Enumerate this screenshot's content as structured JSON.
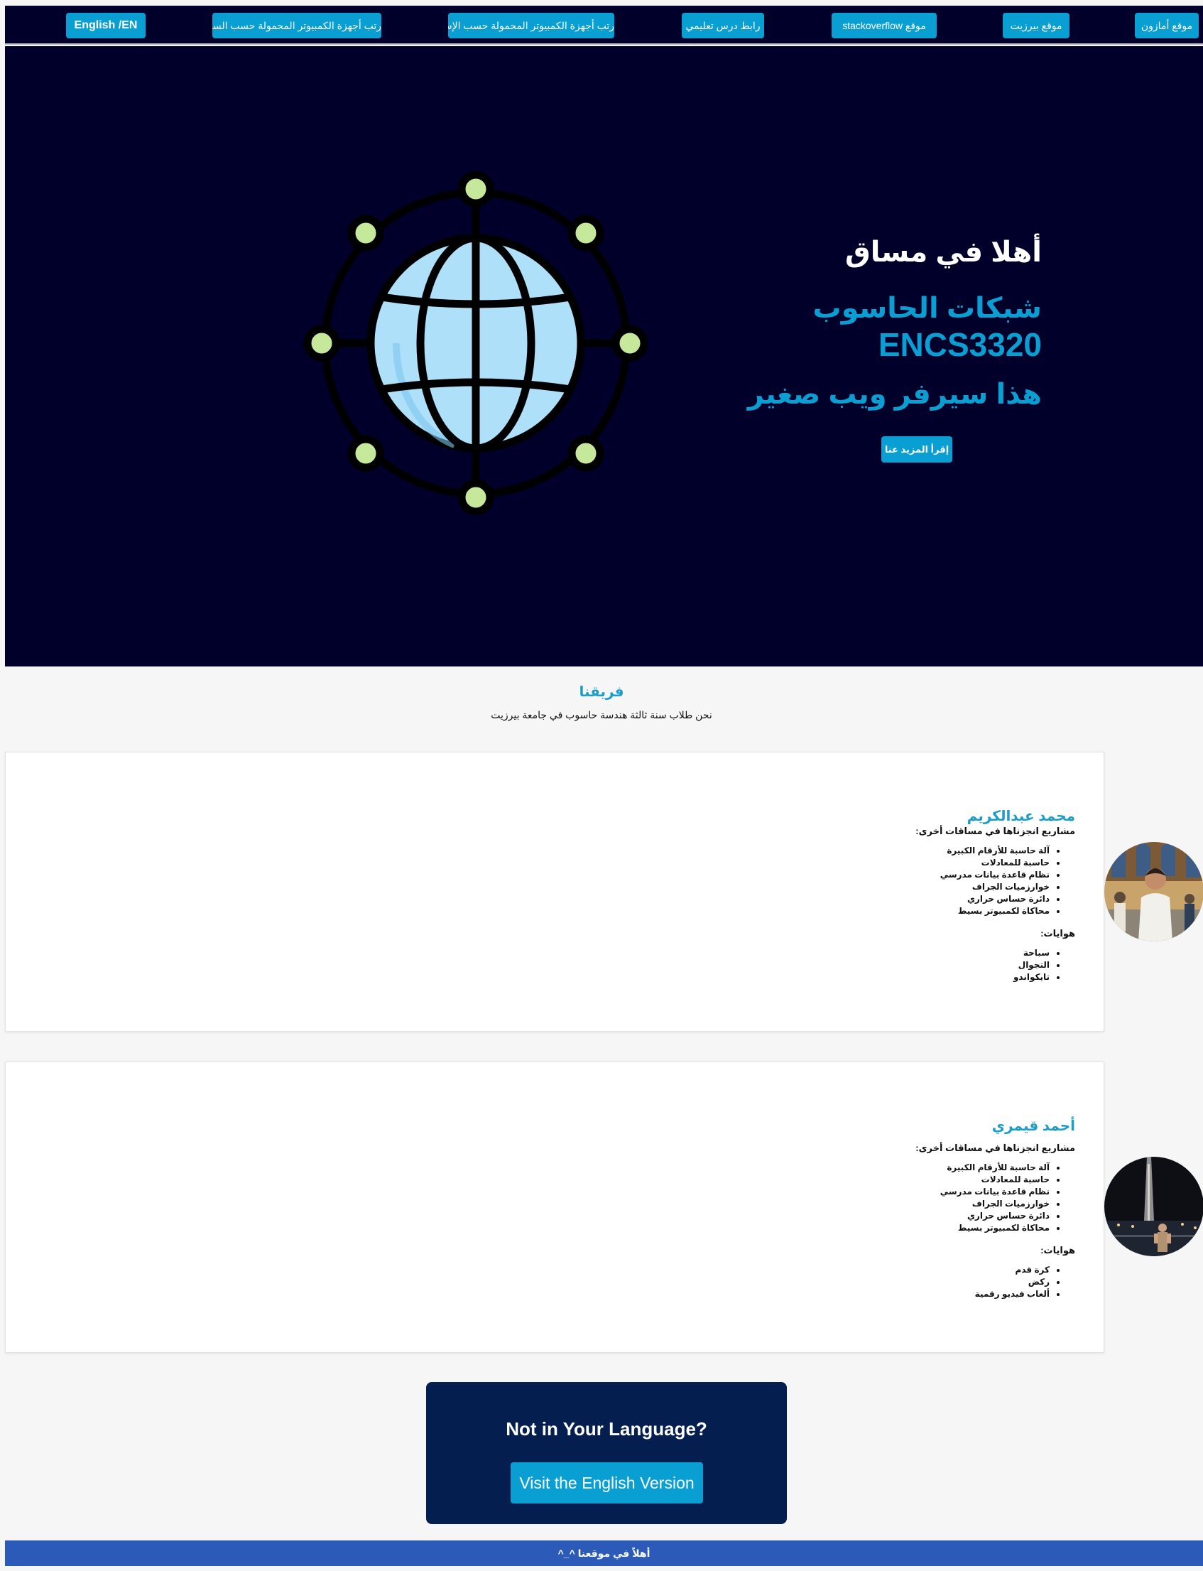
{
  "nav": {
    "items": [
      {
        "label": "موقع أمازون"
      },
      {
        "label": "موقع بيرزيت"
      },
      {
        "label": "موقع stackoverflow"
      },
      {
        "label": "رابط درس تعليمي"
      },
      {
        "label": "رتب أجهزة الكمبيوتر المحمولة حسب الإسم"
      },
      {
        "label": "رتب أجهزة الكمبيوتر المحمولة حسب السعر"
      },
      {
        "label": "English /EN"
      }
    ]
  },
  "hero": {
    "welcome": "أهلا في مساق",
    "subtitle": "شبكات الحاسوب",
    "course_code": "ENCS3320",
    "tagline": "هذا سيرفر ويب صغير",
    "read_more": "إقرأ المزيد عنا",
    "globe_icon": "globe-network-icon",
    "colors": {
      "background": "#00002a",
      "accent": "#0a9fd3",
      "globe": "#aee0f9",
      "nodes": "#c5e89a"
    }
  },
  "team": {
    "title": "فريقنا",
    "subtitle": "نحن طلاب سنة ثالثة هندسة حاسوب في جامعة بيرزيت"
  },
  "members": [
    {
      "name": "محمد عبدالكريم",
      "projects_label": "مشاريع انجزناها في مساقات أخرى:",
      "projects": [
        "آلة حاسبة للأرقام الكبيرة",
        "حاسبة للمعادلات",
        "نظام قاعدة بيانات مدرسي",
        "خوارزميات الجراف",
        "دائرة حساس حراري",
        "محاكاة لكمبيوتر بسيط"
      ],
      "hobbies_label": "هوايات:",
      "hobbies": [
        "سباحة",
        "التجوال",
        "تايكواندو"
      ]
    },
    {
      "name": "أحمد قيمري",
      "projects_label": "مشاريع انجزناها في مساقات أخرى:",
      "projects": [
        "آلة حاسبة للأرقام الكبيرة",
        "حاسبة للمعادلات",
        "نظام قاعدة بيانات مدرسي",
        "خوارزميات الجراف",
        "دائرة حساس حراري",
        "محاكاة لكمبيوتر بسيط"
      ],
      "hobbies_label": "هوايات:",
      "hobbies": [
        "كرة قدم",
        "ركض",
        "ألعاب فيديو رقمية"
      ]
    }
  ],
  "cta": {
    "title": "Not in Your Language?",
    "button": "Visit the English Version"
  },
  "footer": {
    "text": "أهلاً في موقعنا ^_^"
  }
}
